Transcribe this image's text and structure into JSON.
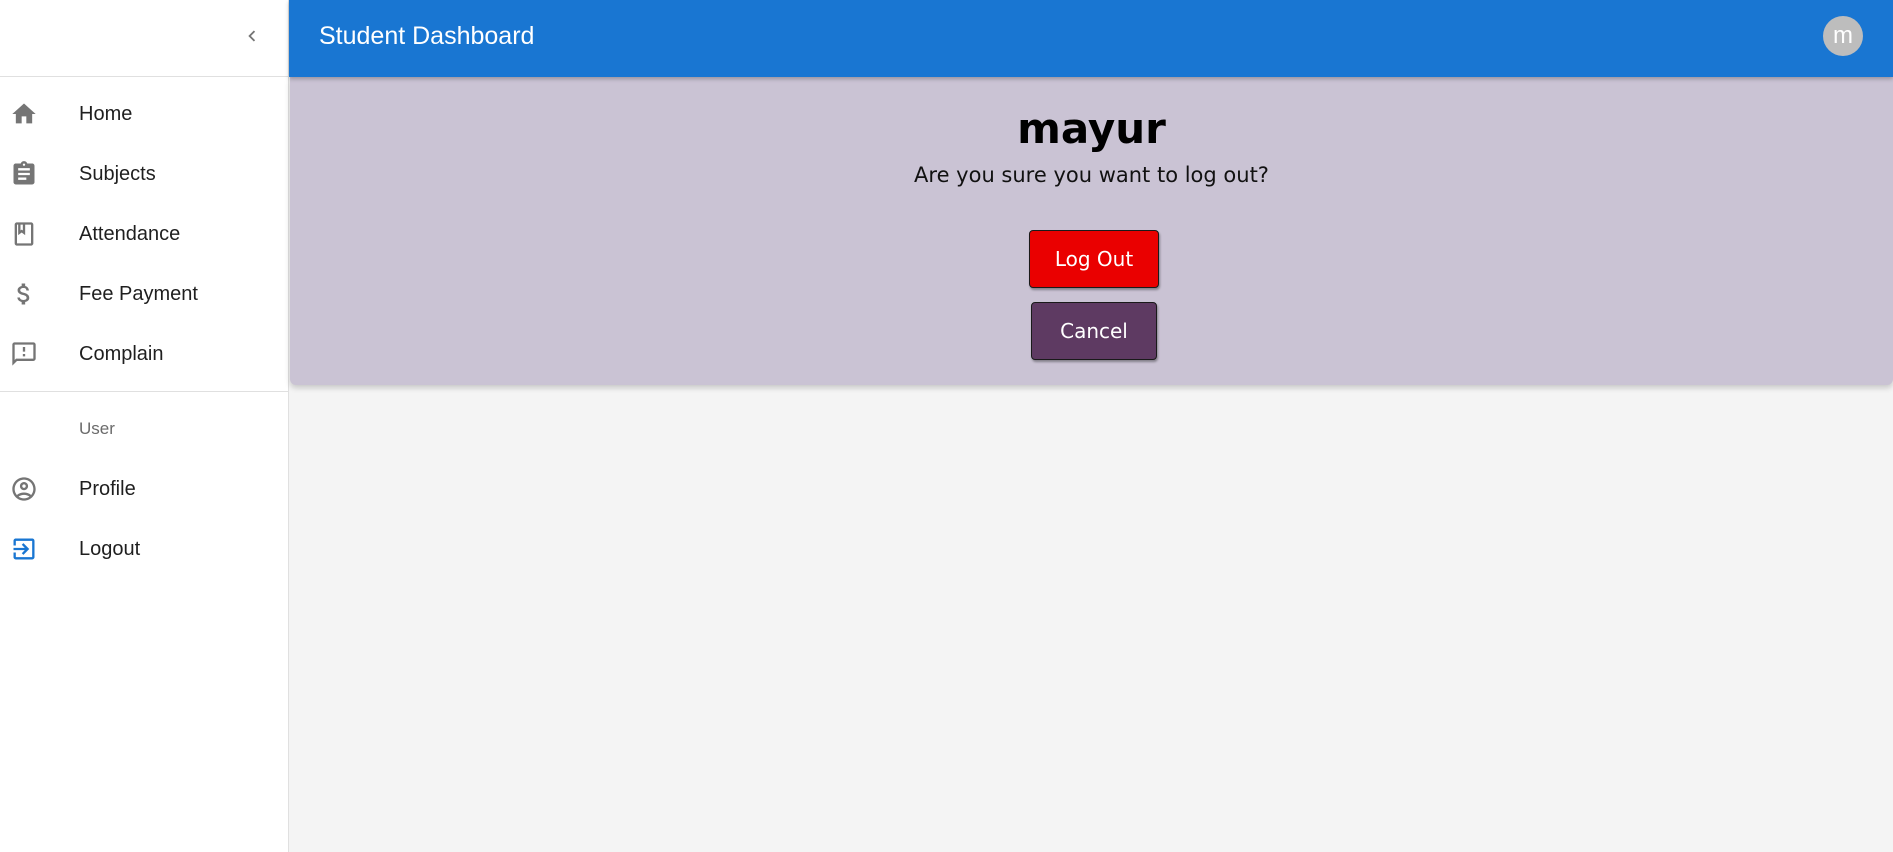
{
  "appbar": {
    "title": "Student Dashboard",
    "avatar_initial": "m"
  },
  "sidebar": {
    "collapse_icon": "chevron-left-icon",
    "items": [
      {
        "label": "Home",
        "icon": "home-icon"
      },
      {
        "label": "Subjects",
        "icon": "assignment-icon"
      },
      {
        "label": "Attendance",
        "icon": "class-bookmark-icon"
      },
      {
        "label": "Fee Payment",
        "icon": "dollar-icon"
      },
      {
        "label": "Complain",
        "icon": "feedback-icon"
      }
    ],
    "user_section_label": "User",
    "user_items": [
      {
        "label": "Profile",
        "icon": "account-circle-icon"
      },
      {
        "label": "Logout",
        "icon": "logout-icon"
      }
    ]
  },
  "logout_panel": {
    "user_name": "mayur",
    "question": "Are you sure you want to log out?",
    "logout_label": "Log Out",
    "cancel_label": "Cancel"
  },
  "colors": {
    "appbar": "#1976d2",
    "panel_bg": "#cac3d4",
    "logout_button": "#ea0000",
    "cancel_button": "#5e3a62",
    "logout_icon": "#1976d2",
    "icon_gray": "#757575"
  }
}
